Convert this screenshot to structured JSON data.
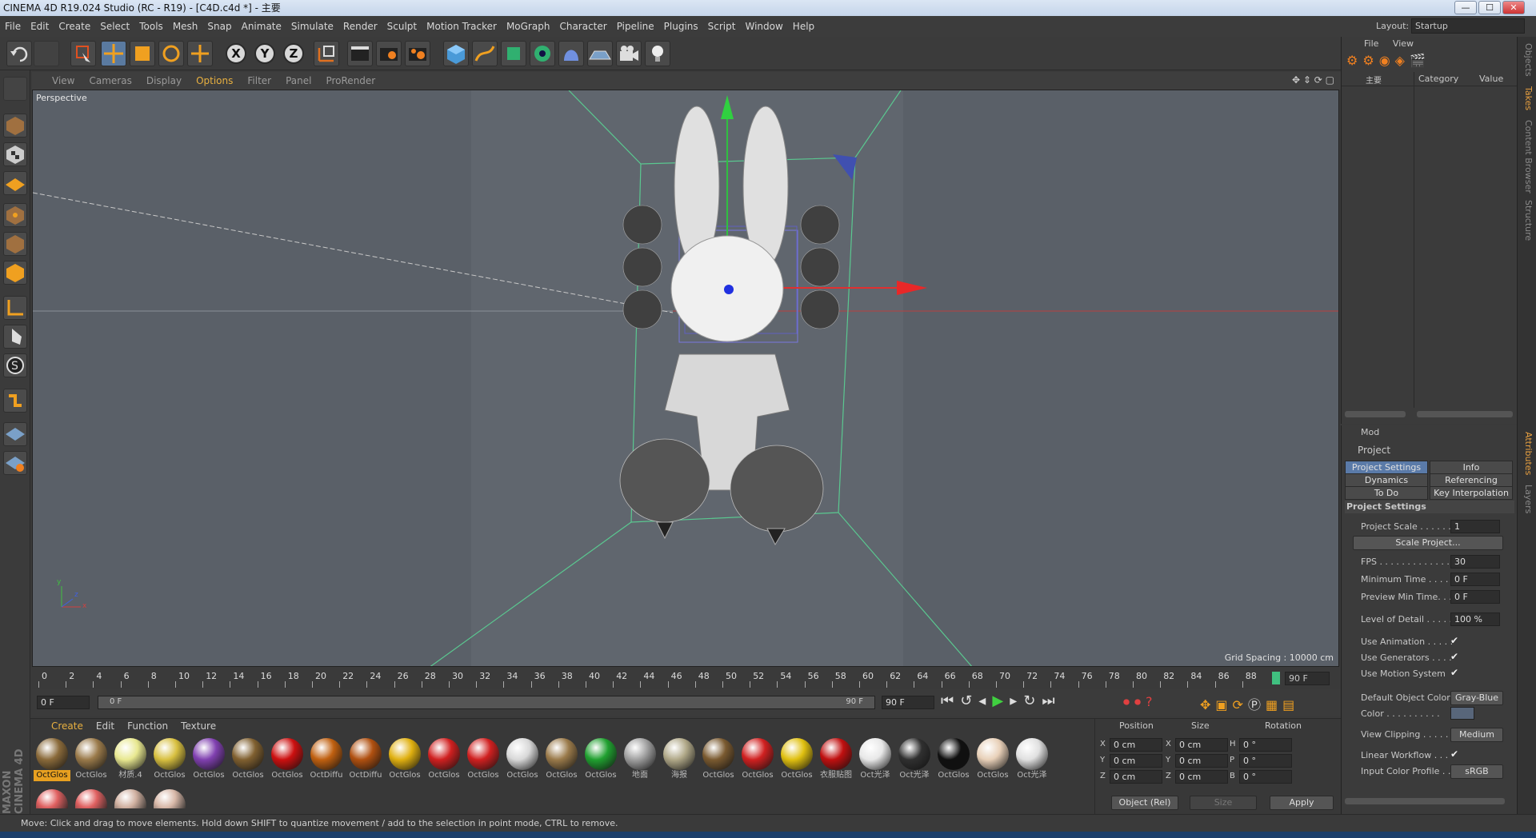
{
  "window": {
    "title": "CINEMA 4D R19.024 Studio (RC - R19) - [C4D.c4d *] - 主要",
    "controls": [
      "—",
      "☐",
      "✕"
    ]
  },
  "menubar": {
    "items": [
      "File",
      "Edit",
      "Create",
      "Select",
      "Tools",
      "Mesh",
      "Snap",
      "Animate",
      "Simulate",
      "Render",
      "Sculpt",
      "Motion Tracker",
      "MoGraph",
      "Character",
      "Pipeline",
      "Plugins",
      "Script",
      "Window",
      "Help"
    ]
  },
  "layout": {
    "label": "Layout:",
    "value": "Startup"
  },
  "toolbar": {
    "axis_x": "X",
    "axis_y": "Y",
    "axis_z": "Z"
  },
  "viewport": {
    "menus": [
      "View",
      "Cameras",
      "Display",
      "Options",
      "Filter",
      "Panel",
      "ProRender"
    ],
    "active_menu": "Options",
    "camera_label": "Perspective",
    "grid_spacing": "Grid Spacing : 10000 cm",
    "axis_y_label": "y",
    "axis_x_label": "x",
    "axis_z_label": "z"
  },
  "timeline": {
    "ticks": [
      "0",
      "2",
      "4",
      "6",
      "8",
      "10",
      "12",
      "14",
      "16",
      "18",
      "20",
      "22",
      "24",
      "26",
      "28",
      "30",
      "32",
      "34",
      "36",
      "38",
      "40",
      "42",
      "44",
      "46",
      "48",
      "50",
      "52",
      "54",
      "56",
      "58",
      "60",
      "62",
      "64",
      "66",
      "68",
      "70",
      "72",
      "74",
      "76",
      "78",
      "80",
      "82",
      "84",
      "86",
      "88"
    ],
    "end_frame": "90 F"
  },
  "transport": {
    "current_frame": "0 F",
    "range_start": "0 F",
    "range_end": "90 F",
    "max_frame": "90 F"
  },
  "materials": {
    "tabs": [
      "Create",
      "Edit",
      "Function",
      "Texture"
    ],
    "items": [
      {
        "label": "OctGlos",
        "color": "#8a6a3a",
        "selected": true
      },
      {
        "label": "OctGlos",
        "color": "#9a7a4a"
      },
      {
        "label": "材质.4",
        "color": "#e8e890"
      },
      {
        "label": "OctGlos",
        "color": "#d8c040"
      },
      {
        "label": "OctGlos",
        "color": "#8040b0"
      },
      {
        "label": "OctGlos",
        "color": "#806030"
      },
      {
        "label": "OctGlos",
        "color": "#cc1010"
      },
      {
        "label": "OctDiffu",
        "color": "#c06010"
      },
      {
        "label": "OctDiffu",
        "color": "#b05010"
      },
      {
        "label": "OctGlos",
        "color": "#e0b010"
      },
      {
        "label": "OctGlos",
        "color": "#d02020"
      },
      {
        "label": "OctGlos",
        "color": "#d02020"
      },
      {
        "label": "OctGlos",
        "color": "#d8d8d8"
      },
      {
        "label": "OctGlos",
        "color": "#9a7a4a"
      },
      {
        "label": "OctGlos",
        "color": "#20a030"
      },
      {
        "label": "地面",
        "color": "#a0a0a0"
      },
      {
        "label": "海报",
        "color": "#b0a888"
      },
      {
        "label": "OctGlos",
        "color": "#7a5a30"
      },
      {
        "label": "OctGlos",
        "color": "#d02020"
      },
      {
        "label": "OctGlos",
        "color": "#e0c010"
      },
      {
        "label": "衣服贴图",
        "color": "#c01010"
      },
      {
        "label": "Oct光泽",
        "color": "#e8e8e8"
      },
      {
        "label": "Oct光泽",
        "color": "#303030"
      },
      {
        "label": "OctGlos",
        "color": "#101010"
      },
      {
        "label": "OctGlos",
        "color": "#e8d0b8"
      },
      {
        "label": "Oct光泽",
        "color": "#e0e0e0"
      }
    ],
    "row2_colors": [
      "#e06060",
      "#e06060",
      "#d0b0a0",
      "#d8b8a8"
    ]
  },
  "coordinates": {
    "headers": [
      "Position",
      "Size",
      "Rotation"
    ],
    "pos": [
      {
        "axis": "X",
        "value": "0 cm"
      },
      {
        "axis": "Y",
        "value": "0 cm"
      },
      {
        "axis": "Z",
        "value": "0 cm"
      }
    ],
    "size": [
      {
        "axis": "X",
        "value": "0 cm"
      },
      {
        "axis": "Y",
        "value": "0 cm"
      },
      {
        "axis": "Z",
        "value": "0 cm"
      }
    ],
    "rot": [
      {
        "axis": "H",
        "value": "0 °"
      },
      {
        "axis": "P",
        "value": "0 °"
      },
      {
        "axis": "B",
        "value": "0 °"
      }
    ],
    "mode": "Object (Rel)",
    "size_mode": "Size",
    "apply": "Apply"
  },
  "object_manager": {
    "menus": [
      "File",
      "View"
    ],
    "layer_item": "主要",
    "col_category": "Category",
    "col_value": "Value"
  },
  "attributes": {
    "mode": "Mod",
    "title": "Project",
    "tabs": [
      {
        "label": "Project Settings",
        "active": true
      },
      {
        "label": "Info"
      },
      {
        "label": "Dynamics"
      },
      {
        "label": "Referencing"
      },
      {
        "label": "To Do"
      },
      {
        "label": "Key Interpolation"
      }
    ],
    "section": "Project Settings",
    "project_scale_label": "Project Scale . . . . . .",
    "project_scale": "1",
    "scale_project_btn": "Scale Project...",
    "fps_label": "FPS . . . . . . . . . . . . . .",
    "fps": "30",
    "min_time_label": "Minimum Time . . . . .",
    "min_time": "0 F",
    "preview_min_label": "Preview Min Time. . .",
    "preview_min": "0 F",
    "lod_label": "Level of Detail . . . . .",
    "lod": "100 %",
    "use_animation": "Use Animation . . . . .",
    "use_generators": "Use Generators . . . .",
    "use_motion": "Use Motion System",
    "default_color_label": "Default Object Color",
    "default_color": "Gray-Blue",
    "color_label": "Color . . . . . . . . . .",
    "view_clipping_label": "View Clipping . . . . .",
    "view_clipping": "Medium",
    "linear_workflow": "Linear Workflow . . .",
    "input_profile_label": "Input Color Profile . .",
    "input_profile": "sRGB"
  },
  "side_tabs": [
    "Objects",
    "Takes",
    "Content Browser",
    "Structure",
    "Attributes",
    "Layers"
  ],
  "status": "Move: Click and drag to move elements. Hold down SHIFT to quantize movement / add to the selection in point mode, CTRL to remove."
}
